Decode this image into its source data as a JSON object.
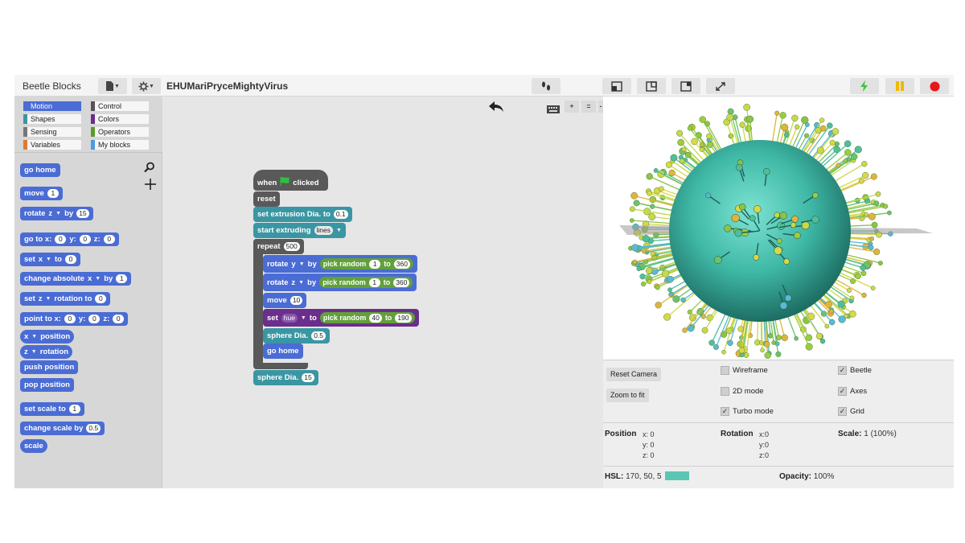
{
  "app": {
    "name": "Beetle Blocks",
    "project": "EHUMariPryceMightyVirus"
  },
  "categories": [
    {
      "label": "Motion",
      "color": "#4a6cd4",
      "selected": true
    },
    {
      "label": "Control",
      "color": "#555555"
    },
    {
      "label": "Shapes",
      "color": "#3a96a3"
    },
    {
      "label": "Colors",
      "color": "#6a2e8c"
    },
    {
      "label": "Sensing",
      "color": "#777777"
    },
    {
      "label": "Operators",
      "color": "#5b9a2d"
    },
    {
      "label": "Variables",
      "color": "#e07a30"
    },
    {
      "label": "My blocks",
      "color": "#4a9ae0"
    }
  ],
  "palette": {
    "go_home": "go home",
    "move": "move",
    "move_val": "1",
    "rotate": "rotate",
    "rotate_axis": "z",
    "rotate_by": "by",
    "rotate_val": "15",
    "goto": "go to x:",
    "goto_y": "y:",
    "goto_z": "z:",
    "goto_x_val": "0",
    "goto_y_val": "0",
    "goto_z_val": "0",
    "set": "set",
    "set_axis": "x",
    "set_to": "to",
    "set_val": "0",
    "change_abs": "change absolute",
    "change_abs_axis": "x",
    "change_abs_by": "by",
    "change_abs_val": "1",
    "set_rot": "set",
    "set_rot_axis": "z",
    "set_rot_mid": "rotation to",
    "set_rot_val": "0",
    "point": "point to x:",
    "point_y": "y:",
    "point_z": "z:",
    "point_x_val": "0",
    "point_y_val": "0",
    "point_z_val": "0",
    "position_axis": "x",
    "position": "position",
    "rotation_axis": "z",
    "rotation": "rotation",
    "push": "push position",
    "pop": "pop position",
    "set_scale": "set scale to",
    "set_scale_val": "1",
    "change_scale": "change scale by",
    "change_scale_val": "0.5",
    "scale": "scale"
  },
  "script": {
    "when": "when",
    "clicked": "clicked",
    "reset": "reset",
    "extrusion": "set extrusion Dia. to",
    "extrusion_val": "0.1",
    "start_extruding": "start extruding",
    "start_extruding_mode": "lines",
    "repeat": "repeat",
    "repeat_val": "500",
    "rot_y": "rotate",
    "rot_y_axis": "y",
    "rot_y_by": "by",
    "pick_random": "pick random",
    "pick_to": "to",
    "rot_y_from": "1",
    "rot_y_to": "360",
    "rot_z": "rotate",
    "rot_z_axis": "z",
    "rot_z_by": "by",
    "rot_z_from": "1",
    "rot_z_to": "360",
    "move": "move",
    "move_val": "10",
    "set_hue": "set",
    "hue": "hue",
    "hue_to": "to",
    "hue_from": "40",
    "hue_to_val": "190",
    "sphere_inner": "sphere Dia.",
    "sphere_inner_val": "0.5",
    "go_home": "go home",
    "sphere_outer": "sphere Dia.",
    "sphere_outer_val": "15"
  },
  "zoom": {
    "plus": "+",
    "eq": "=",
    "minus": "-"
  },
  "controls": {
    "reset_camera": "Reset Camera",
    "zoom_fit": "Zoom to fit",
    "wireframe": "Wireframe",
    "wireframe_checked": false,
    "mode2d": "2D mode",
    "mode2d_checked": false,
    "turbo": "Turbo mode",
    "turbo_checked": true,
    "beetle": "Beetle",
    "beetle_checked": true,
    "axes": "Axes",
    "axes_checked": true,
    "grid": "Grid",
    "grid_checked": true
  },
  "status": {
    "position": "Position",
    "pos_x": "x: 0",
    "pos_y": "y: 0",
    "pos_z": "z: 0",
    "rotation": "Rotation",
    "rot_x": "x:0",
    "rot_y": "y:0",
    "rot_z": "z:0",
    "scale": "Scale:",
    "scale_val": "1 (100%)",
    "hsl": "HSL:",
    "hsl_val": "170, 50, 5",
    "hsl_color": "#5cc6b4",
    "opacity": "Opacity:",
    "opacity_val": "100%"
  }
}
